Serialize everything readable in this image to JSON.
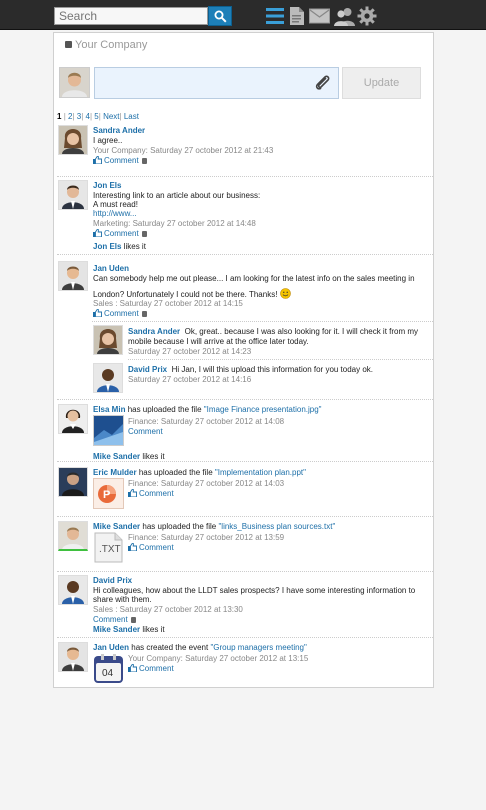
{
  "search": {
    "placeholder": "Search"
  },
  "header": {
    "company": "Your Company",
    "update_label": "Update"
  },
  "pager": {
    "current": "1",
    "pages": [
      "2",
      "3",
      "4",
      "5"
    ],
    "next": "Next",
    "last": "Last"
  },
  "posts": [
    {
      "author": "Sandra Ander",
      "text": "I agree..",
      "meta": "Your Company: Saturday 27 october 2012 at 21:43",
      "comment": "Comment"
    },
    {
      "author": "Jon Els",
      "text1": "Interesting link to an article about our business:",
      "text2": "A must read!",
      "link": "http://www...",
      "meta": "Marketing: Saturday 27 october 2012 at 14:48",
      "comment": "Comment",
      "like_name": "Jon Els",
      "like_text": "likes it"
    },
    {
      "author": "Jan Uden",
      "text1": "Can somebody help me out please... I am looking for the latest info on the sales meeting in",
      "text2": "London? Unfortunately I could not be there. Thanks!",
      "meta": "Sales : Saturday 27 october 2012 at 14:15",
      "comment": "Comment",
      "replies": [
        {
          "author": "Sandra Ander",
          "text1": "Ok, great.. because I was also looking for it. I will check it from my",
          "text2": "mobile because I will arrive at the office later today.",
          "meta": "Saturday 27 october 2012 at 14:23"
        },
        {
          "author": "David Prix",
          "text1": "Hi Jan, I will this upload this information for you today ok.",
          "meta": "Saturday 27 october 2012 at 14:16"
        }
      ]
    },
    {
      "author": "Elsa Min",
      "action": "has uploaded the file",
      "file": "\"Image Finance presentation.jpg\"",
      "meta": "Finance: Saturday 27 october 2012 at 14:08",
      "comment": "Comment",
      "like_name": "Mike Sander",
      "like_text": "likes it"
    },
    {
      "author": "Eric Mulder",
      "action": "has uploaded the file",
      "file": "\"Implementation plan.ppt\"",
      "meta": "Finance: Saturday 27 october 2012 at 14:03",
      "comment": "Comment"
    },
    {
      "author": "Mike Sander",
      "action": "has uploaded the file",
      "file": "\"links_Business plan sources.txt\"",
      "meta": "Finance: Saturday 27 october 2012 at 13:59",
      "comment": "Comment",
      "file_label": ".TXT"
    },
    {
      "author": "David Prix",
      "text1": "Hi colleagues, how about the LLDT sales prospects? I have some interesting information to",
      "text2": "share with them.",
      "meta": "Sales : Saturday 27 october 2012 at 13:30",
      "comment": "Comment",
      "like_name": "Mike Sander",
      "like_text": "likes it"
    },
    {
      "author": "Jan Uden",
      "action": "has created the event",
      "file": "\"Group managers meeting\"",
      "meta": "Your Company: Saturday 27 october 2012 at 13:15",
      "comment": "Comment",
      "cal_day": "04"
    }
  ],
  "colors": {
    "topbar": "#2b2b2b",
    "accent": "#1d7fb8",
    "link": "#1d6fa8"
  }
}
